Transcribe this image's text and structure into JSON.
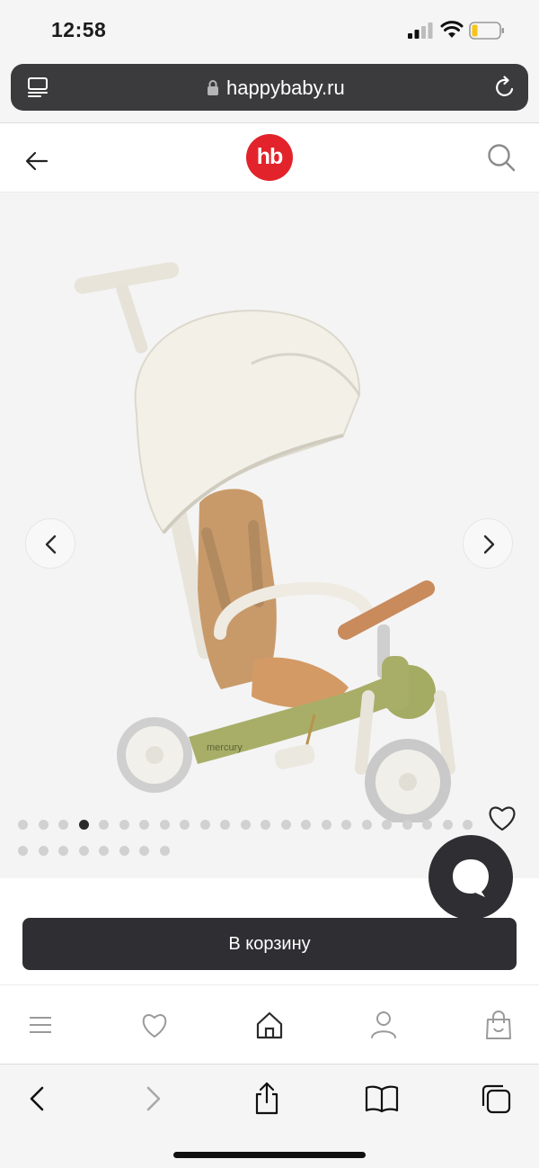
{
  "status_bar": {
    "time": "12:58",
    "icons": [
      "cellular-signal-icon",
      "wifi-icon",
      "battery-icon"
    ]
  },
  "browser": {
    "url": "happybaby.ru",
    "icons": [
      "page-menu-icon",
      "lock-icon",
      "reload-icon"
    ]
  },
  "header": {
    "logo_text": "hb",
    "logo_color": "#e2232b",
    "icons": [
      "back-arrow-icon",
      "search-icon"
    ]
  },
  "gallery": {
    "image": "tricycle-stroller-image",
    "image_brand_text": "mercury",
    "current_slide": 4,
    "total_slides": 31,
    "icons": [
      "chevron-left-icon",
      "chevron-right-icon",
      "heart-icon"
    ]
  },
  "chat": {
    "icon": "chat-bubble-icon"
  },
  "cta": {
    "add_to_cart_label": "В корзину",
    "button_color": "#2f2f33"
  },
  "site_nav": {
    "items": [
      {
        "name": "menu",
        "icon": "menu-icon"
      },
      {
        "name": "favorites",
        "icon": "heart-icon"
      },
      {
        "name": "home",
        "icon": "home-icon"
      },
      {
        "name": "profile",
        "icon": "user-icon"
      },
      {
        "name": "cart",
        "icon": "shopping-bag-icon"
      }
    ]
  },
  "safari_toolbar": {
    "items": [
      {
        "name": "back",
        "icon": "chevron-left-icon"
      },
      {
        "name": "forward",
        "icon": "chevron-right-icon"
      },
      {
        "name": "share",
        "icon": "share-icon"
      },
      {
        "name": "bookmarks",
        "icon": "book-icon"
      },
      {
        "name": "tabs",
        "icon": "tabs-icon"
      }
    ]
  }
}
